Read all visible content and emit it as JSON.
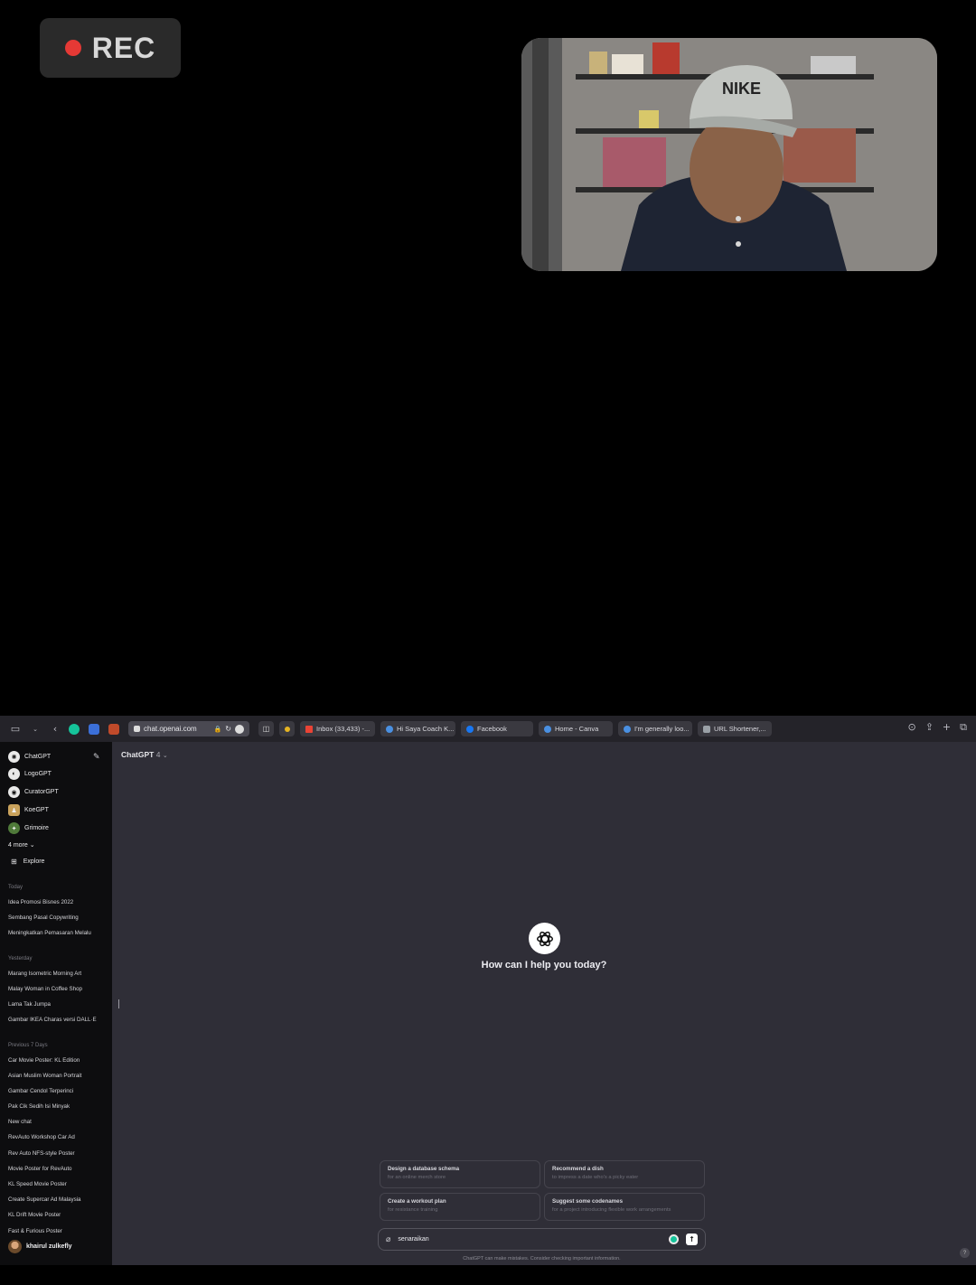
{
  "recording": {
    "label": "REC"
  },
  "browser": {
    "url": "chat.openai.com",
    "tabs": [
      {
        "label": "Inbox (33,433) -...",
        "color": "#ea4335"
      },
      {
        "label": "Hi Saya Coach K...",
        "color": "#4a90e2"
      },
      {
        "label": "Facebook",
        "color": "#1877f2"
      },
      {
        "label": "Home - Canva",
        "color": "#4a90e2"
      },
      {
        "label": "I'm generally loo...",
        "color": "#4a90e2"
      },
      {
        "label": "URL Shortener,...",
        "color": "#9aa0a6"
      }
    ]
  },
  "sidebar": {
    "gpts": [
      {
        "label": "ChatGPT",
        "icon": "openai-logo-icon"
      },
      {
        "label": "LogoGPT",
        "icon": "logo-gpt-icon"
      },
      {
        "label": "CuratorGPT",
        "icon": "curator-gpt-icon"
      },
      {
        "label": "KoeGPT",
        "icon": "koe-gpt-icon"
      },
      {
        "label": "Grimoire",
        "icon": "grimoire-icon"
      }
    ],
    "more_label": "4 more",
    "explore_label": "Explore",
    "sections": [
      {
        "heading": "Today",
        "items": [
          "Idea Promosi Bisnes 2022",
          "Sembang Pasal Copywriting",
          "Meningkatkan Pemasaran Melalu"
        ]
      },
      {
        "heading": "Yesterday",
        "items": [
          "Marang Isometric Morning Art",
          "Malay Woman in Coffee Shop",
          "Lama Tak Jumpa",
          "Gambar IKEA Charas versi DALL·E"
        ]
      },
      {
        "heading": "Previous 7 Days",
        "items": [
          "Car Movie Poster: KL Edition",
          "Asian Muslim Woman Portrait",
          "Gambar Cendol Terperinci",
          "Pak Cik Sedih Isi Minyak",
          "New chat",
          "RevAuto Workshop Car Ad",
          "Rev Auto NFS-style Poster",
          "Movie Poster for RevAuto",
          "KL Speed Movie Poster",
          "Create Supercar Ad Malaysia",
          "KL Drift Movie Poster",
          "Fast & Furious Poster"
        ]
      }
    ],
    "user_name": "khairul zulkefly"
  },
  "main": {
    "model_name": "ChatGPT",
    "model_version": "4",
    "welcome": "How can I help you today?",
    "suggestions": [
      {
        "title": "Design a database schema",
        "subtitle": "for an online merch store"
      },
      {
        "title": "Recommend a dish",
        "subtitle": "to impress a date who's a picky eater"
      },
      {
        "title": "Create a workout plan",
        "subtitle": "for resistance training"
      },
      {
        "title": "Suggest some codenames",
        "subtitle": "for a project introducing flexible work arrangements"
      }
    ],
    "input_value": "senaraikan",
    "disclaimer": "ChatGPT can make mistakes. Consider checking important information.",
    "help_label": "?"
  }
}
